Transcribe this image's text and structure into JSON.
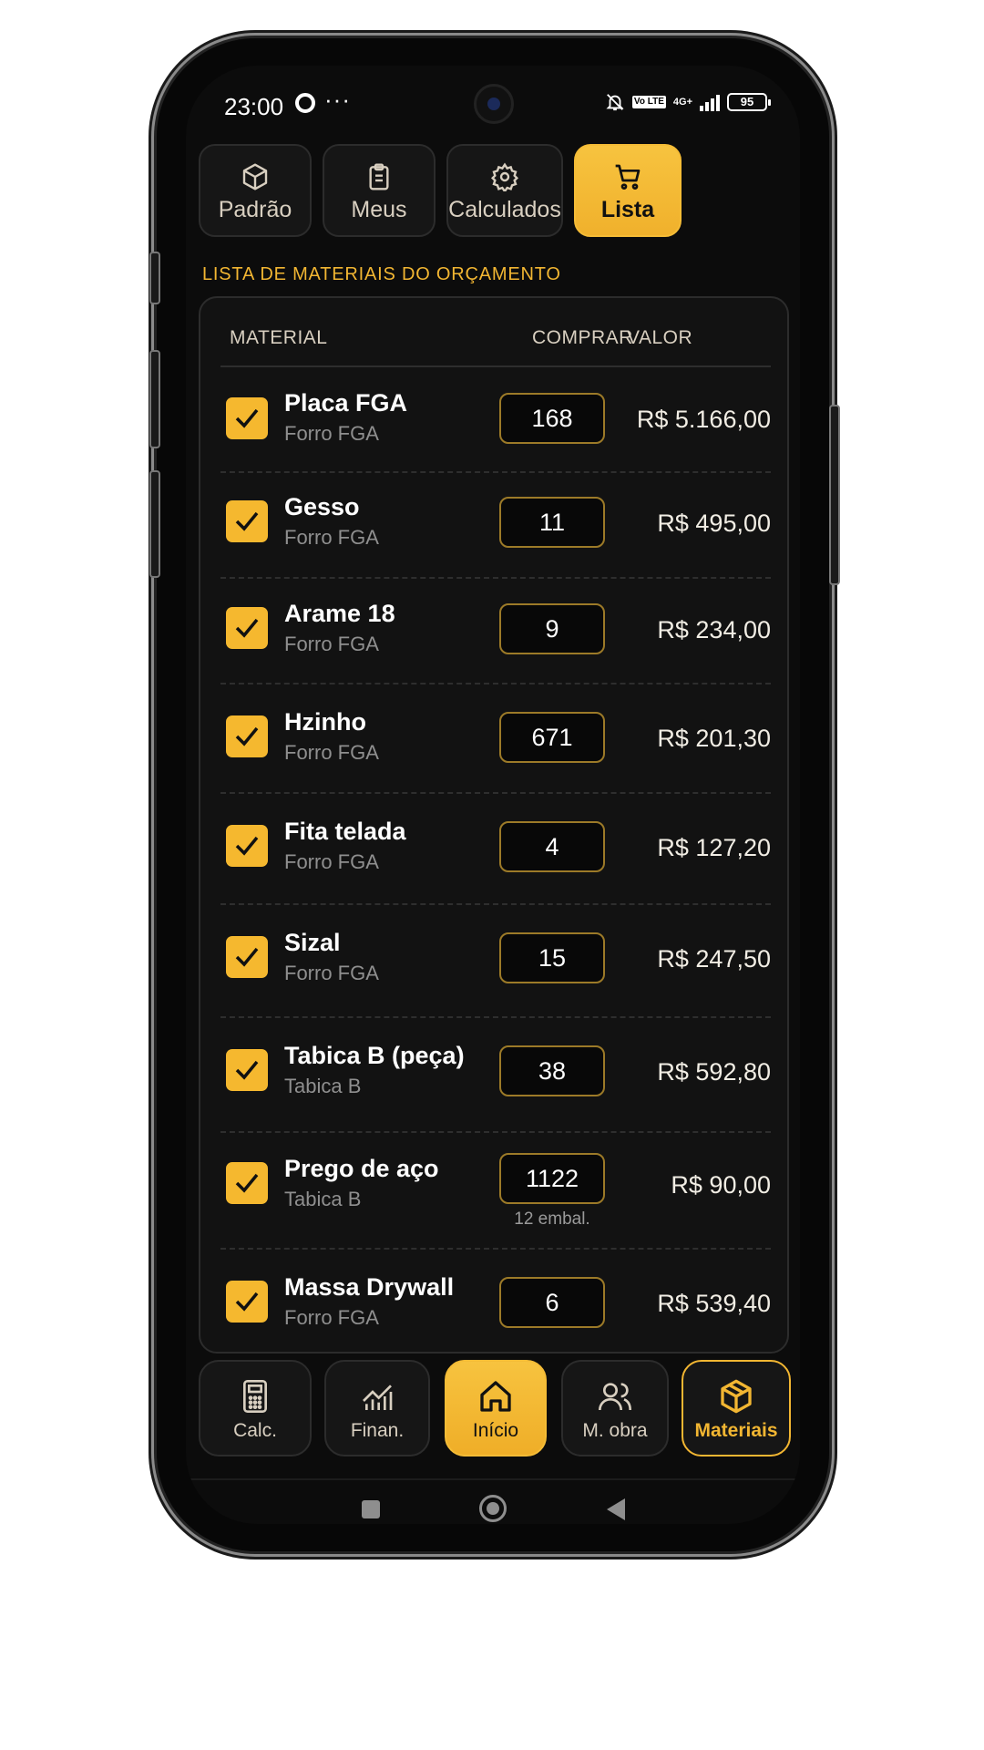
{
  "status_bar": {
    "time": "23:00",
    "battery": "95",
    "network": "4G+",
    "volte": "Vo LTE"
  },
  "tabs": [
    {
      "label": "Padrão",
      "icon": "package-icon"
    },
    {
      "label": "Meus",
      "icon": "clipboard-icon"
    },
    {
      "label": "Calculados",
      "icon": "gear-icon"
    },
    {
      "label": "Lista",
      "icon": "cart-icon",
      "active": true
    }
  ],
  "section_title": "LISTA DE MATERIAIS DO ORÇAMENTO",
  "table": {
    "col_material": "MATERIAL",
    "col_comprar": "COMPRAR",
    "col_valor": "VALOR",
    "rows": [
      {
        "name": "Placa FGA",
        "category": "Forro FGA",
        "qty": "168",
        "price": "R$ 5.166,00",
        "checked": true
      },
      {
        "name": "Gesso",
        "category": "Forro FGA",
        "qty": "11",
        "price": "R$ 495,00",
        "checked": true
      },
      {
        "name": "Arame 18",
        "category": "Forro FGA",
        "qty": "9",
        "price": "R$ 234,00",
        "checked": true
      },
      {
        "name": "Hzinho",
        "category": "Forro FGA",
        "qty": "671",
        "price": "R$ 201,30",
        "checked": true
      },
      {
        "name": "Fita telada",
        "category": "Forro FGA",
        "qty": "4",
        "price": "R$ 127,20",
        "checked": true
      },
      {
        "name": "Sizal",
        "category": "Forro FGA",
        "qty": "15",
        "price": "R$ 247,50",
        "checked": true
      },
      {
        "name": "Tabica B (peça)",
        "category": "Tabica B",
        "qty": "38",
        "price": "R$ 592,80",
        "checked": true
      },
      {
        "name": "Prego de aço",
        "category": "Tabica B",
        "qty": "1122",
        "pack": "12 embal.",
        "price": "R$ 90,00",
        "checked": true
      },
      {
        "name": "Massa Drywall",
        "category": "Forro FGA",
        "qty": "6",
        "price": "R$ 539,40",
        "checked": true
      }
    ]
  },
  "bottom_nav": [
    {
      "label": "Calc.",
      "icon": "calculator-icon"
    },
    {
      "label": "Finan.",
      "icon": "chart-icon"
    },
    {
      "label": "Início",
      "icon": "home-icon"
    },
    {
      "label": "M. obra",
      "icon": "users-icon"
    },
    {
      "label": "Materiais",
      "icon": "package-icon",
      "selected": true
    }
  ],
  "colors": {
    "accent": "#f5b82f",
    "background": "#0c0c0c",
    "card": "#121212",
    "muted_text": "#8f8f8f"
  }
}
